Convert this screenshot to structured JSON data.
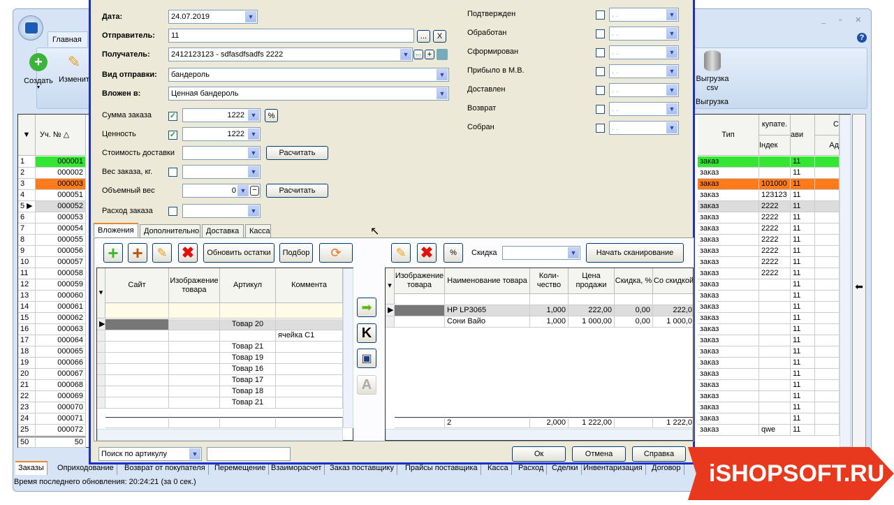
{
  "app": {
    "tab_main": "Главная",
    "btn_create": "Создать",
    "btn_edit": "Изменить",
    "btn_export": "Выгрузка csv",
    "group_export": "Выгрузка",
    "help": "?"
  },
  "grid": {
    "col_num": "Уч. №",
    "col_type": "Тип",
    "col_buyer": "купате.",
    "col_index": "Індек",
    "col_avi": "ави",
    "col_c": "С",
    "col_addr": "Ад",
    "rows": [
      {
        "n": "1",
        "id": "000001",
        "type": "заказ",
        "idx": "",
        "avi": "11",
        "color": "#33e633"
      },
      {
        "n": "2",
        "id": "000002",
        "type": "заказ",
        "idx": "",
        "avi": "11"
      },
      {
        "n": "3",
        "id": "000003",
        "type": "заказ",
        "idx": "101000",
        "avi": "11",
        "color": "#ff7a1a"
      },
      {
        "n": "4",
        "id": "000051",
        "type": "заказ",
        "idx": "123123",
        "avi": "11"
      },
      {
        "n": "5",
        "id": "000052",
        "type": "заказ",
        "idx": "2222",
        "avi": "11",
        "color": "#dcdcdc",
        "current": true
      },
      {
        "n": "6",
        "id": "000053",
        "type": "заказ",
        "idx": "2222",
        "avi": "11"
      },
      {
        "n": "7",
        "id": "000054",
        "type": "заказ",
        "idx": "2222",
        "avi": "11"
      },
      {
        "n": "8",
        "id": "000055",
        "type": "заказ",
        "idx": "2222",
        "avi": "11"
      },
      {
        "n": "9",
        "id": "000056",
        "type": "заказ",
        "idx": "2222",
        "avi": "11"
      },
      {
        "n": "10",
        "id": "000057",
        "type": "заказ",
        "idx": "2222",
        "avi": "11"
      },
      {
        "n": "11",
        "id": "000058",
        "type": "заказ",
        "idx": "2222",
        "avi": "11"
      },
      {
        "n": "12",
        "id": "000059",
        "type": "заказ",
        "idx": "",
        "avi": "11"
      },
      {
        "n": "13",
        "id": "000060",
        "type": "заказ",
        "idx": "",
        "avi": "11"
      },
      {
        "n": "14",
        "id": "000061",
        "type": "заказ",
        "idx": "",
        "avi": "11"
      },
      {
        "n": "15",
        "id": "000062",
        "type": "заказ",
        "idx": "",
        "avi": "11"
      },
      {
        "n": "16",
        "id": "000063",
        "type": "заказ",
        "idx": "",
        "avi": "11"
      },
      {
        "n": "17",
        "id": "000064",
        "type": "заказ",
        "idx": "",
        "avi": "11"
      },
      {
        "n": "18",
        "id": "000065",
        "type": "заказ",
        "idx": "",
        "avi": "11"
      },
      {
        "n": "19",
        "id": "000066",
        "type": "заказ",
        "idx": "",
        "avi": "11"
      },
      {
        "n": "20",
        "id": "000067",
        "type": "заказ",
        "idx": "",
        "avi": "11"
      },
      {
        "n": "21",
        "id": "000068",
        "type": "заказ",
        "idx": "",
        "avi": "11"
      },
      {
        "n": "22",
        "id": "000069",
        "type": "заказ",
        "idx": "",
        "avi": "11"
      },
      {
        "n": "23",
        "id": "000070",
        "type": "заказ",
        "idx": "",
        "avi": "11"
      },
      {
        "n": "24",
        "id": "000071",
        "type": "заказ",
        "idx": "",
        "avi": "11"
      },
      {
        "n": "25",
        "id": "000072",
        "type": "заказ",
        "idx": "qwe",
        "avi": "11"
      }
    ],
    "footer_n": "50",
    "footer_count": "50"
  },
  "bottom_tabs": [
    "Заказы",
    "Оприходование",
    "Возврат от покупателя",
    "Перемещение",
    "Взаиморасчет",
    "Заказ поставщику",
    "Прайсы поставщика",
    "Касса",
    "Расход",
    "Сделки",
    "Инвентаризация",
    "Договор"
  ],
  "status": "Время последнего обновления: 20:24:21 (за 0 сек.)",
  "dialog": {
    "date_label": "Дата:",
    "date": "24.07.2019",
    "sender_label": "Отправитель:",
    "sender": "11",
    "sender_btn": "...",
    "sender_clear": "X",
    "recipient_label": "Получатель:",
    "recipient": "2412123123 - sdfasdfsadfs 2222",
    "ship_type_label": "Вид отправки:",
    "ship_type": "бандероль",
    "enclosed_label": "Вложен в:",
    "enclosed": "Ценная бандероль",
    "sum_label": "Сумма заказа",
    "sum": "1222",
    "pct": "%",
    "value_label": "Ценность",
    "value": "1222",
    "delivery_label": "Стоимость доставки",
    "calc": "Расчитать",
    "weight_label": "Вес заказа, кг.",
    "vol_label": "Объемный вес",
    "vol": "0",
    "expense_label": "Расход заказа",
    "statuses": [
      {
        "label": "Подтвержден",
        "value": ". ."
      },
      {
        "label": "Обработан",
        "value": ". ."
      },
      {
        "label": "Сформирован",
        "value": ". ."
      },
      {
        "label": "Прибыло в М.В.",
        "value": ". ."
      },
      {
        "label": "Доставлен",
        "value": ". ."
      },
      {
        "label": "Возврат",
        "value": ". ."
      },
      {
        "label": "Собран",
        "value": ". ."
      }
    ],
    "tabs": [
      "Вложения",
      "Дополнительно",
      "Доставка",
      "Касса"
    ],
    "refresh_btn": "Обновить остатки",
    "pick_btn": "Подбор",
    "left_cols": [
      "Сайт",
      "Изображение товара",
      "Артикул",
      "Коммента"
    ],
    "left_rows": [
      [
        "",
        "",
        "Товар 20",
        ""
      ],
      [
        "",
        "",
        "",
        "ячейка С1"
      ],
      [
        "",
        "",
        "Товар 21",
        ""
      ],
      [
        "",
        "",
        "Товар 19",
        ""
      ],
      [
        "",
        "",
        "Товар 16",
        ""
      ],
      [
        "",
        "",
        "Товар 17",
        ""
      ],
      [
        "",
        "",
        "Товар 18",
        ""
      ],
      [
        "",
        "",
        "Товар 21",
        ""
      ]
    ],
    "discount_label": "Скидка",
    "scan_btn": "Начать сканирование",
    "right_cols": [
      "Изображение товара",
      "Наименование товара",
      "Коли-чество",
      "Цена продажи",
      "Скидка, %",
      "Со скидкой"
    ],
    "right_rows": [
      [
        "",
        "HP LP3065",
        "1,000",
        "222,00",
        "0,00",
        "222,0"
      ],
      [
        "",
        "Сони Вайо",
        "1,000",
        "1 000,00",
        "0,00",
        "1 000,0"
      ]
    ],
    "right_footer": [
      "",
      "2",
      "2,000",
      "1 222,00",
      "",
      "1 222,0"
    ],
    "search_mode": "Поиск по артикулу",
    "search_value": "",
    "ok": "Ок",
    "cancel": "Отмена",
    "help": "Справка"
  },
  "watermark": "iSHOPSOFT.RU",
  "colors": {
    "dialog_border": "#1a2fd0",
    "row_green": "#33e633",
    "row_orange": "#ff7a1a",
    "watermark": "#e8391f"
  }
}
